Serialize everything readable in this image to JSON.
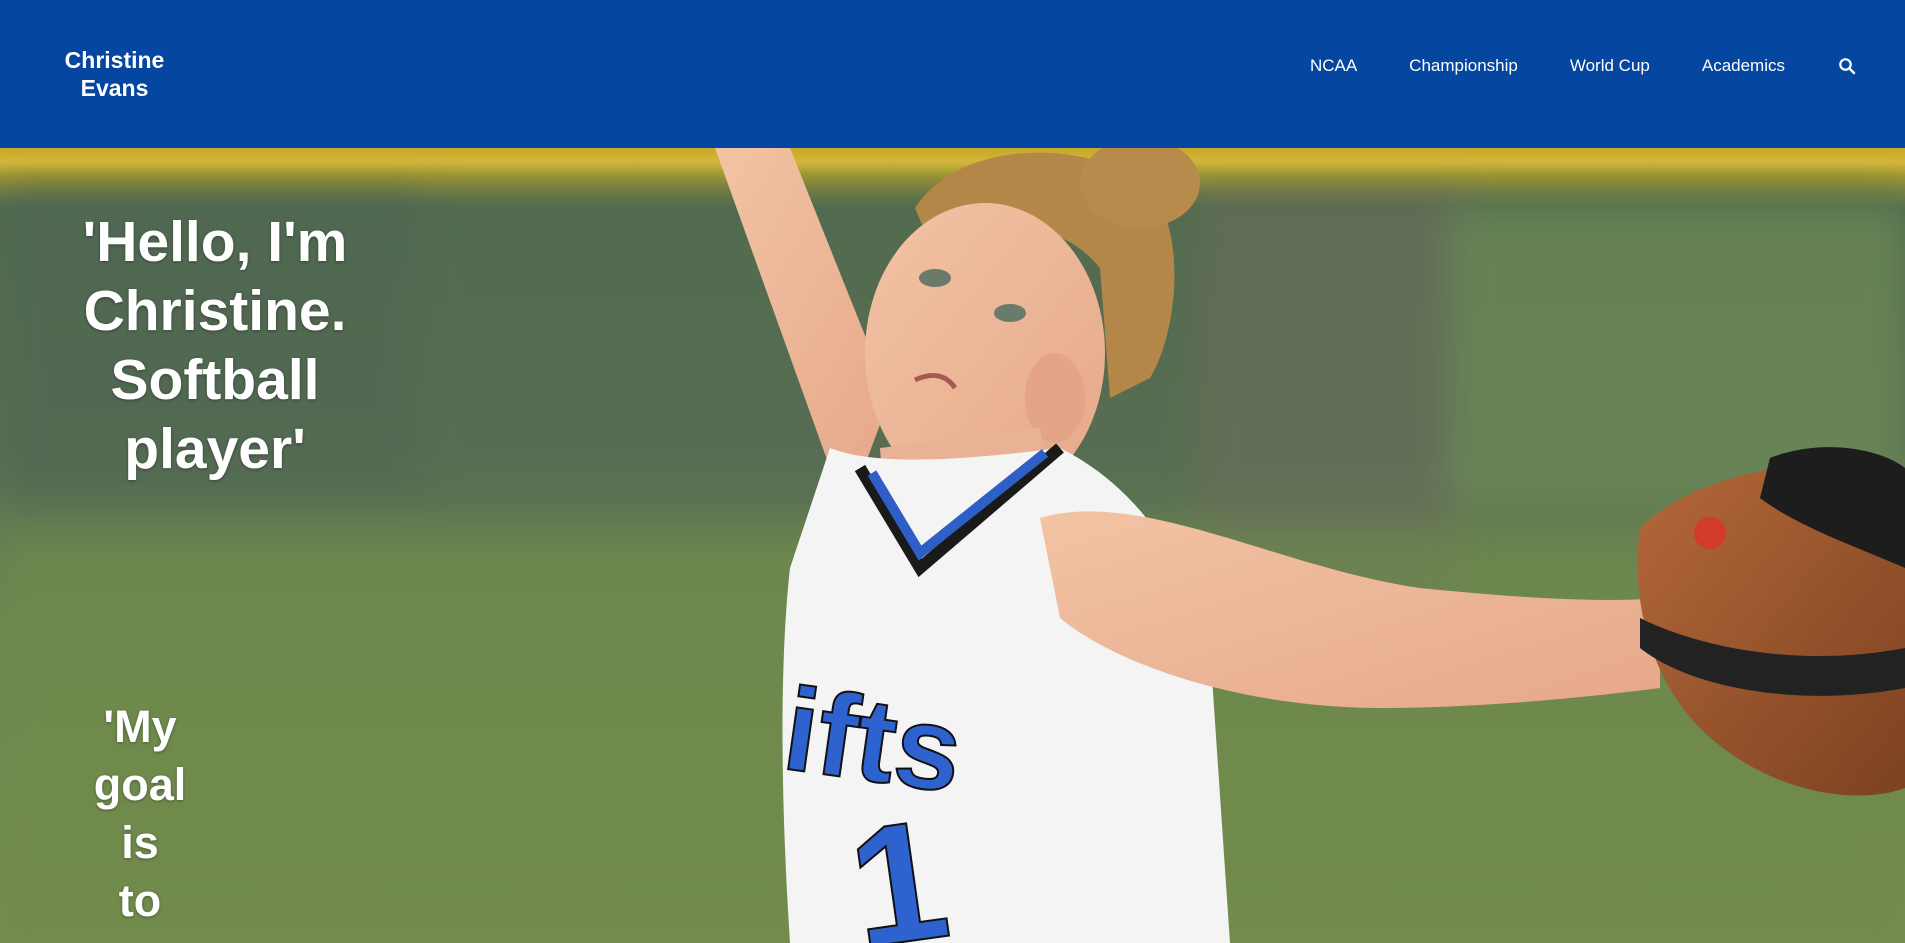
{
  "header": {
    "brand": "Christine Evans",
    "nav": [
      {
        "label": "NCAA"
      },
      {
        "label": "Championship"
      },
      {
        "label": "World Cup"
      },
      {
        "label": "Academics"
      }
    ],
    "search_icon": "search-icon",
    "background_color": "#0546a0"
  },
  "hero": {
    "headline": "'Hello, I'm Christine. Softball player'",
    "goal_text": "'My goal is to t",
    "image_description_icon": "softball-pitcher-photo"
  }
}
